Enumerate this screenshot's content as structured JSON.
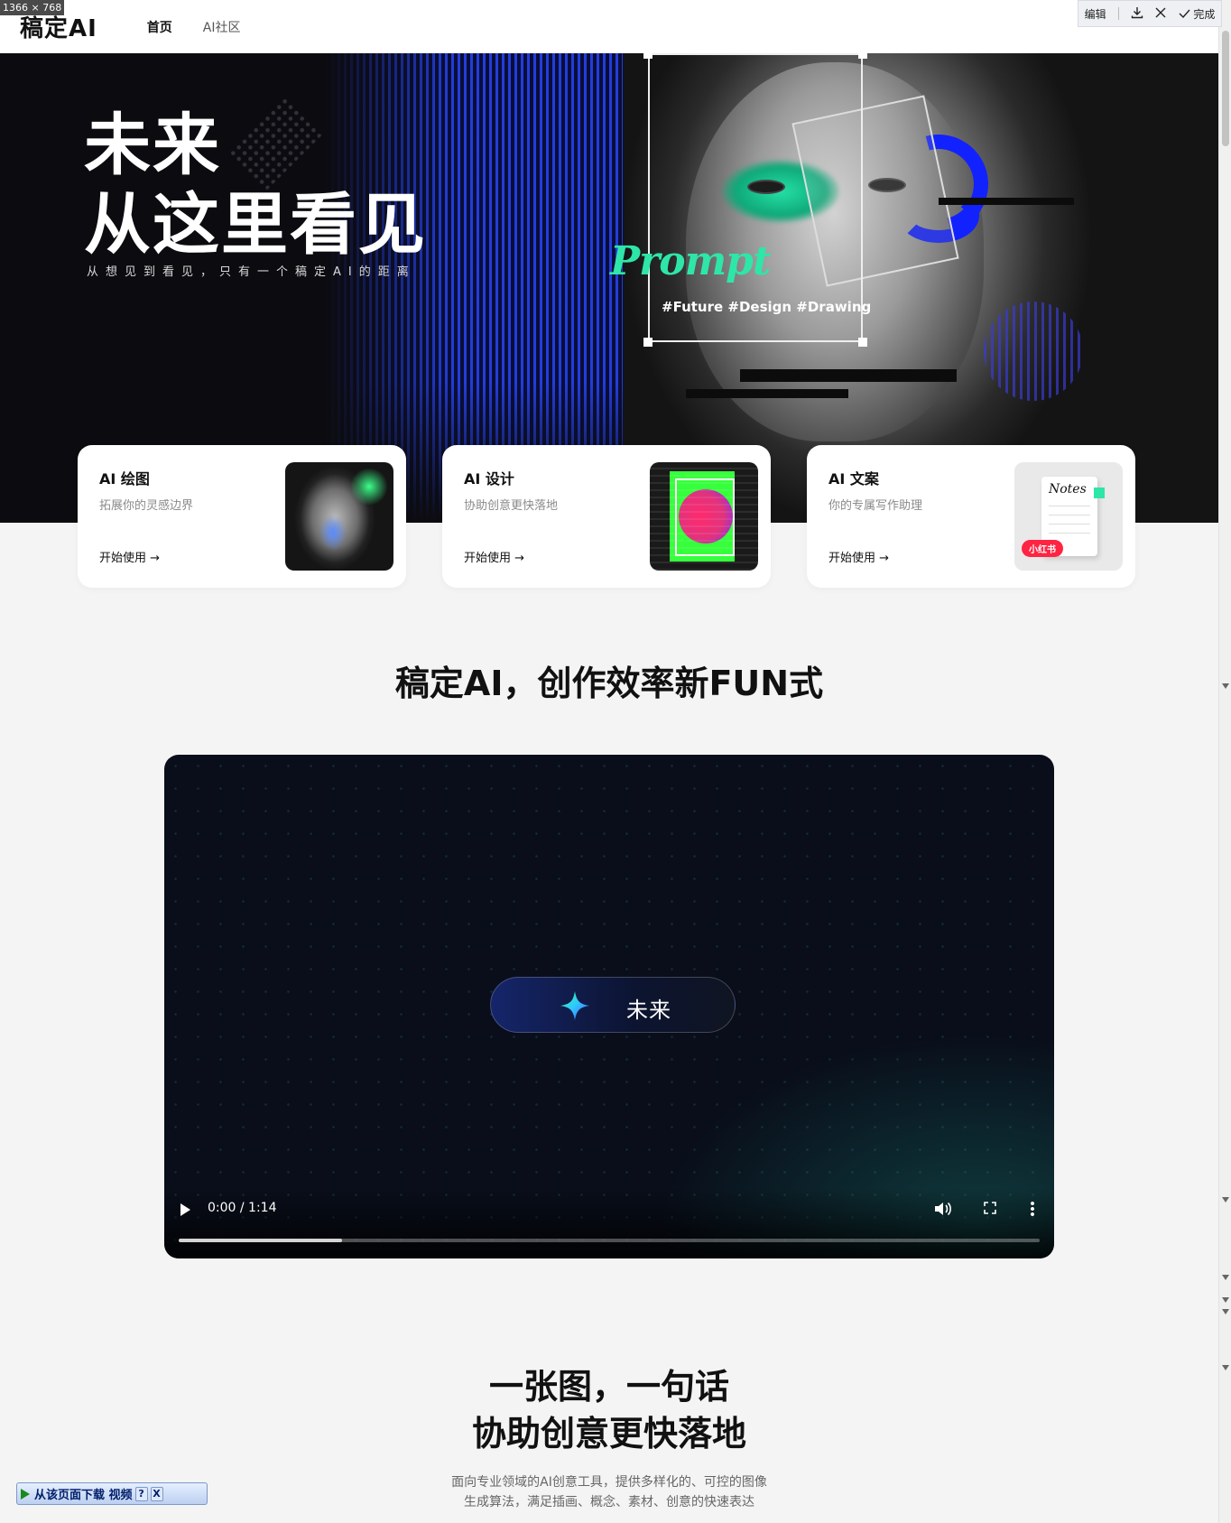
{
  "screenshot_overlay": {
    "dimension_label": "1366 × 768",
    "toolbar": {
      "edit_label": "编辑",
      "done_label": "完成"
    }
  },
  "header": {
    "logo": "稿定AI",
    "nav": [
      {
        "label": "首页",
        "active": true
      },
      {
        "label": "AI社区",
        "active": false
      }
    ]
  },
  "hero": {
    "title_line1": "未来",
    "title_line2": "从这里看见",
    "subtitle": "从想见到看见，只有一个稿定AI的距离",
    "art_word": "Prompt",
    "art_tags": "#Future #Design #Drawing"
  },
  "cards": [
    {
      "title": "AI 绘图",
      "desc": "拓展你的灵感边界",
      "link": "开始使用 →"
    },
    {
      "title": "AI 设计",
      "desc": "协助创意更快落地",
      "link": "开始使用 →"
    },
    {
      "title": "AI 文案",
      "desc": "你的专属写作助理",
      "link": "开始使用 →",
      "thumb_note": "Notes",
      "thumb_badge": "小红书"
    }
  ],
  "section1": {
    "title": "稿定AI，创作效率新FUN式"
  },
  "video": {
    "pill_text": "未来",
    "time": "0:00 / 1:14",
    "progress": 0.19
  },
  "section2": {
    "title_line1": "一张图，一句话",
    "title_line2": "协助创意更快落地",
    "desc_line1": "面向专业领域的AI创意工具，提供多样化的、可控的图像",
    "desc_line2": "生成算法，满足插画、概念、素材、创意的快速表达"
  },
  "download_bar": {
    "label": "从该页面下载 视频",
    "help": "?",
    "close": "X"
  },
  "colors": {
    "accent_green": "#2ee6a8",
    "accent_blue": "#1222ff",
    "page_bg": "#f4f4f4"
  }
}
